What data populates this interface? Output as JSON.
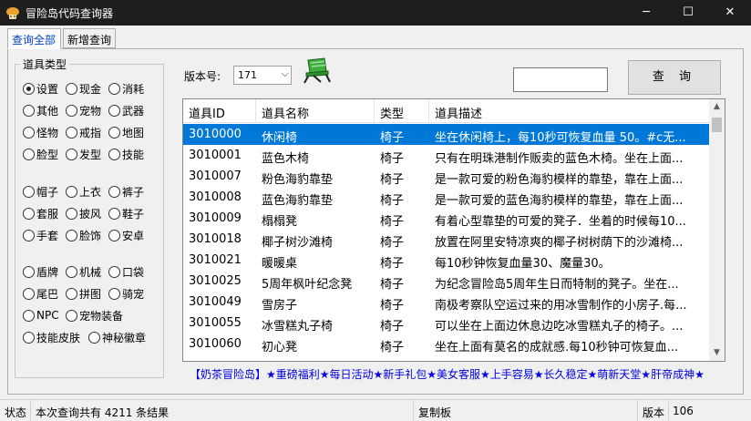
{
  "window": {
    "title": "冒险岛代码查询器",
    "controls": [
      "─",
      "☐",
      "✕"
    ]
  },
  "tabs": [
    {
      "label": "查询全部",
      "active": true
    },
    {
      "label": "新增查询",
      "active": false
    }
  ],
  "filter": {
    "legend": "道具类型",
    "options": [
      "设置",
      "现金",
      "消耗",
      "其他",
      "宠物",
      "武器",
      "怪物",
      "戒指",
      "地图",
      "脸型",
      "发型",
      "技能",
      "帽子",
      "上衣",
      "裤子",
      "套服",
      "披风",
      "鞋子",
      "手套",
      "脸饰",
      "安卓",
      "盾牌",
      "机械",
      "口袋",
      "尾巴",
      "拼图",
      "骑宠",
      "NPC",
      "宠物装备",
      "技能皮肤",
      "神秘徽章"
    ],
    "selected": "设置"
  },
  "version": {
    "label": "版本号:",
    "value": "171"
  },
  "search": {
    "value": "",
    "button_label": "查 询"
  },
  "table": {
    "columns": [
      "道具ID",
      "道具名称",
      "类型",
      "道具描述"
    ],
    "selected_index": 0,
    "rows": [
      [
        "3010000",
        "休闲椅",
        "椅子",
        "坐在休闲椅上，每10秒可恢复血量 50。#c无..."
      ],
      [
        "3010001",
        "蓝色木椅",
        "椅子",
        "只有在明珠港制作贩卖的蓝色木椅。坐在上面..."
      ],
      [
        "3010007",
        "粉色海豹靠垫",
        "椅子",
        "是一款可爱的粉色海豹模样的靠垫，靠在上面..."
      ],
      [
        "3010008",
        "蓝色海豹靠垫",
        "椅子",
        "是一款可爱的蓝色海豹模样的靠垫，靠在上面..."
      ],
      [
        "3010009",
        "榻榻凳",
        "椅子",
        "有着心型靠垫的可爱的凳子．坐着的时候每10..."
      ],
      [
        "3010018",
        "椰子树沙滩椅",
        "椅子",
        "放置在阿里安特凉爽的椰子树树荫下的沙滩椅..."
      ],
      [
        "3010021",
        "暖暖桌",
        "椅子",
        "每10秒钟恢复血量30、魔量30。"
      ],
      [
        "3010025",
        "5周年枫叶纪念凳",
        "椅子",
        "为纪念冒险岛5周年生日而特制的凳子。坐在..."
      ],
      [
        "3010049",
        "雪房子",
        "椅子",
        "南极考察队空运过来的用冰雪制作的小房子.每..."
      ],
      [
        "3010055",
        "冰雪糕丸子椅",
        "椅子",
        "可以坐在上面边休息边吃冰雪糕丸子的椅子。..."
      ],
      [
        "3010060",
        "初心凳",
        "椅子",
        "坐在上面有莫名的成就感.每10秒钟可恢复血..."
      ]
    ]
  },
  "banner": "【奶茶冒险岛】★重磅福利★每日活动★新手礼包★美女客服★上手容易★长久稳定★萌新天堂★肝帝成神★",
  "status": {
    "label": "状态",
    "message": "本次查询共有 4211 条结果",
    "clipboard": "复制板",
    "version_label": "版本",
    "version_value": "106"
  },
  "colors": {
    "titlebar": "#1e1e1e",
    "selection": "#0078d7",
    "banner_text": "#0000e0",
    "tab_active_text": "#0040c0"
  }
}
